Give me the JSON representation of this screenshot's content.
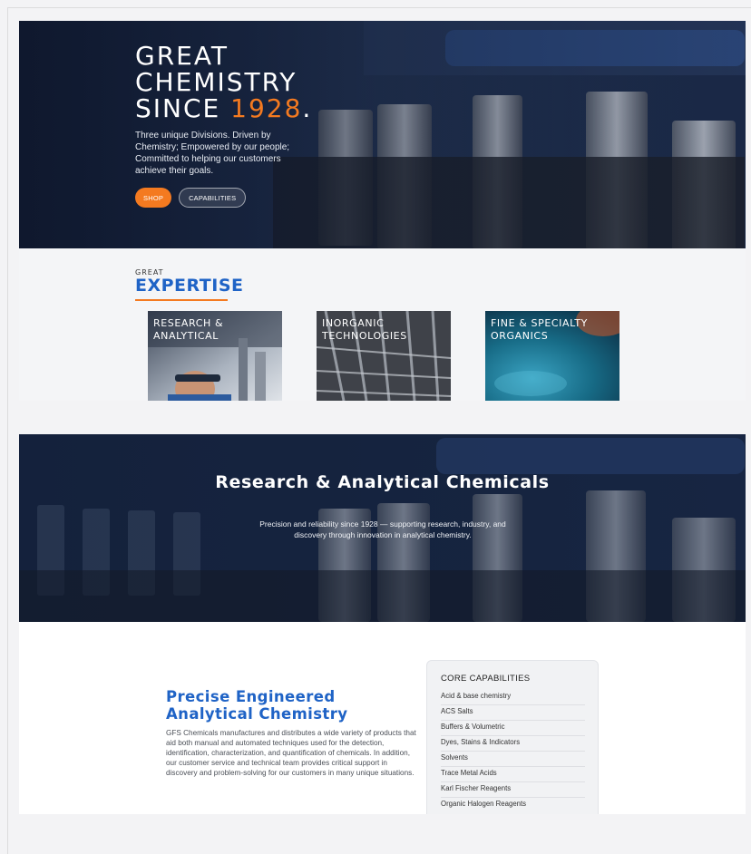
{
  "hero": {
    "title_line1": "GREAT",
    "title_line2": "CHEMISTRY",
    "title_line3_prefix": "SINCE ",
    "title_year": "1928",
    "title_period": ".",
    "text": "Three unique Divisions. Driven by Chemistry; Empowered by our people; Committed to helping our customers achieve their goals.",
    "buttons": {
      "shop": "SHOP",
      "capabilities": "CAPABILITIES"
    }
  },
  "expertise": {
    "eyebrow": "GREAT",
    "title": "EXPERTISE",
    "cards": [
      {
        "label": "RESEARCH & ANALYTICAL"
      },
      {
        "label": "INORGANIC TECHNOLOGIES"
      },
      {
        "label": "FINE & SPECIALTY ORGANICS"
      }
    ]
  },
  "banner": {
    "title": "Research & Analytical Chemicals",
    "subtitle": "Precision and reliability since 1928 — supporting research, industry, and discovery through innovation in analytical chemistry."
  },
  "analytical": {
    "title": "Precise Engineered Analytical Chemistry",
    "body": "GFS Chemicals manufactures and distributes a wide variety of products that aid both manual and automated techniques used for the detection, identification, characterization, and quantification of chemicals. In addition, our customer service and technical team provides critical support in discovery and problem-solving for our customers in many unique situations.",
    "capabilities": {
      "title": "CORE CAPABILITIES",
      "items": [
        "Acid & base chemistry",
        "ACS Salts",
        "Buffers & Volumetric",
        "Dyes, Stains & Indicators",
        "Solvents",
        "Trace Metal Acids",
        "Karl Fischer Reagents",
        "Organic Halogen Reagents"
      ]
    }
  },
  "colors": {
    "accent_orange": "#f47a20",
    "brand_blue": "#1f63c6",
    "hero_navy": "#15203a"
  }
}
